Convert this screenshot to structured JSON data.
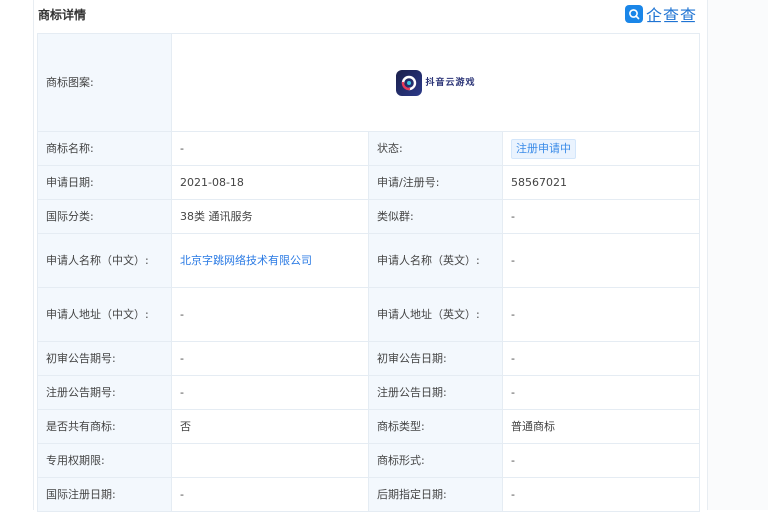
{
  "header": {
    "title": "商标详情",
    "brand": "企查查"
  },
  "image_row": {
    "label": "商标图案:",
    "logo_text": "抖音云游戏"
  },
  "rows": [
    {
      "l1": "商标名称:",
      "v1": "-",
      "l2": "状态:",
      "v2": "注册申请中"
    },
    {
      "l1": "申请日期:",
      "v1": "2021-08-18",
      "l2": "申请/注册号:",
      "v2": "58567021"
    },
    {
      "l1": "国际分类:",
      "v1": "38类 通讯服务",
      "l2": "类似群:",
      "v2": "-"
    },
    {
      "l1": "申请人名称（中文）:",
      "v1": "北京字跳网络技术有限公司",
      "l2": "申请人名称（英文）:",
      "v2": "-"
    },
    {
      "l1": "申请人地址（中文）:",
      "v1": "-",
      "l2": "申请人地址（英文）:",
      "v2": "-"
    },
    {
      "l1": "初审公告期号:",
      "v1": "-",
      "l2": "初审公告日期:",
      "v2": "-"
    },
    {
      "l1": "注册公告期号:",
      "v1": "-",
      "l2": "注册公告日期:",
      "v2": "-"
    },
    {
      "l1": "是否共有商标:",
      "v1": "否",
      "l2": "商标类型:",
      "v2": "普通商标"
    },
    {
      "l1": "专用权期限:",
      "v1": "",
      "l2": "商标形式:",
      "v2": "-"
    },
    {
      "l1": "国际注册日期:",
      "v1": "-",
      "l2": "后期指定日期:",
      "v2": "-"
    }
  ],
  "colors": {
    "label_bg": "#f3f8fd",
    "border": "#e5ecf3",
    "link": "#2a7ae4",
    "brand": "#1f74d3"
  }
}
